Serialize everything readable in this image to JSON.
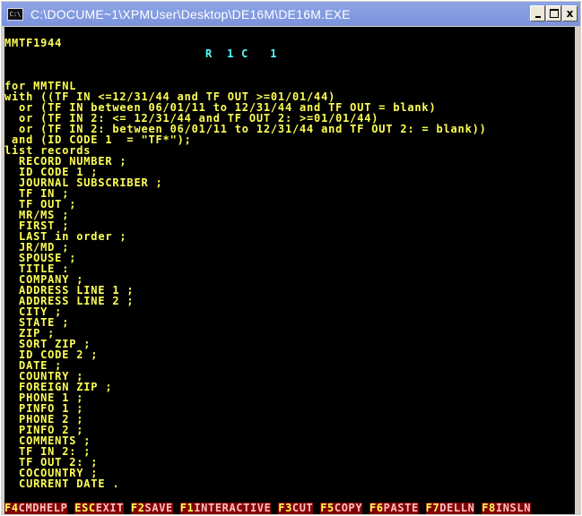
{
  "window": {
    "title": "C:\\DOCUME~1\\XPMUser\\Desktop\\DE16M\\DE16M.EXE",
    "icon": "console-icon",
    "icon_text": "C:\\",
    "controls": {
      "minimize": "minimize-icon",
      "maximize": "maximize-icon",
      "close_label": "x"
    }
  },
  "status": {
    "filename": "MMTF1944",
    "position": "R  1 C   1"
  },
  "colors": {
    "text": "#ffff55",
    "status_position": "#55ffff",
    "background": "#000000",
    "footer_bg": "#800000",
    "footer_label": "#ffbfbf"
  },
  "editor_lines": [
    "",
    "",
    "",
    "",
    "for MMTFNL",
    "with ((TF IN <=12/31/44 and TF OUT >=01/01/44)",
    "  or (TF IN between 06/01/11 to 12/31/44 and TF OUT = blank)",
    "  or (TF IN 2: <= 12/31/44 and TF OUT 2: >=01/01/44)",
    "  or (TF IN 2: between 06/01/11 to 12/31/44 and TF OUT 2: = blank))",
    " and (ID CODE 1  = \"TF*\");",
    "list records",
    "  RECORD NUMBER ;",
    "  ID CODE 1 ;",
    "  JOURNAL SUBSCRIBER ;",
    "  TF IN ;",
    "  TF OUT ;",
    "  MR/MS ;",
    "  FIRST ;",
    "  LAST in order ;",
    "  JR/MD ;",
    "  SPOUSE ;",
    "  TITLE :",
    "  COMPANY ;",
    "  ADDRESS LINE 1 ;",
    "  ADDRESS LINE 2 ;",
    "  CITY ;",
    "  STATE ;",
    "  ZIP ;",
    "  SORT ZIP ;",
    "  ID CODE 2 ;",
    "  DATE ;",
    "  COUNTRY ;",
    "  FOREIGN ZIP ;",
    "  PHONE 1 ;",
    "  PINFO 1 ;",
    "  PHONE 2 ;",
    "  PINFO 2 ;",
    "  COMMENTS ;",
    "  TF IN 2: ;",
    "  TF OUT 2: ;",
    "  COCOUNTRY ;",
    "  CURRENT DATE ."
  ],
  "footer": [
    {
      "key": "F4",
      "label": "CMDHELP"
    },
    {
      "key": "ESC",
      "label": "EXIT"
    },
    {
      "key": "F2",
      "label": "SAVE"
    },
    {
      "key": "F1",
      "label": "INTERACTIVE"
    },
    {
      "key": "F3",
      "label": "CUT"
    },
    {
      "key": "F5",
      "label": "COPY"
    },
    {
      "key": "F6",
      "label": "PASTE"
    },
    {
      "key": "F7",
      "label": "DELLN"
    },
    {
      "key": "F8",
      "label": "INSLN"
    }
  ]
}
